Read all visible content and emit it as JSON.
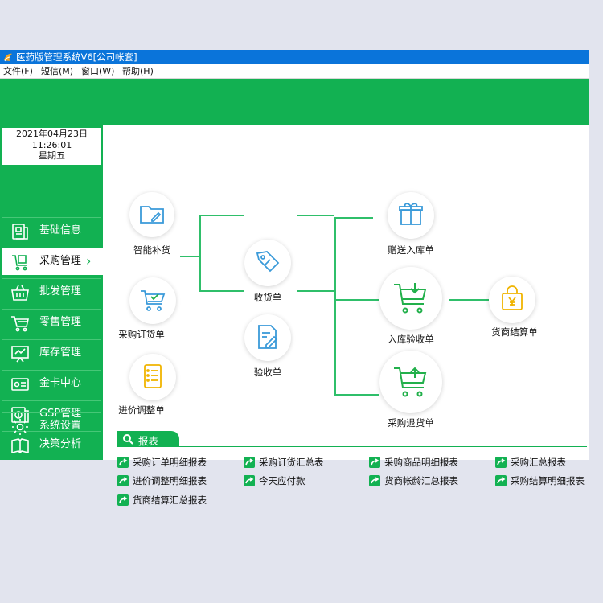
{
  "window": {
    "title": "医药版管理系统V6[公司帐套]"
  },
  "menu": [
    {
      "label": "文件(F)"
    },
    {
      "label": "短信(M)"
    },
    {
      "label": "窗口(W)"
    },
    {
      "label": "帮助(H)"
    }
  ],
  "clock": {
    "date": "2021年04月23日",
    "time": "11:26:01",
    "weekday": "星期五"
  },
  "sidebar": {
    "items": [
      {
        "label": "基础信息",
        "icon": "info-doc-icon"
      },
      {
        "label": "采购管理",
        "icon": "purchase-icon",
        "active": true
      },
      {
        "label": "批发管理",
        "icon": "basket-icon"
      },
      {
        "label": "零售管理",
        "icon": "cart-icon"
      },
      {
        "label": "库存管理",
        "icon": "board-icon"
      },
      {
        "label": "金卡中心",
        "icon": "card-icon"
      },
      {
        "label": "GSP管理",
        "icon": "coins-icon"
      },
      {
        "label": "决策分析",
        "icon": "book-icon"
      },
      {
        "label": "系统设置",
        "icon": "gear-icon"
      }
    ]
  },
  "flow": {
    "smart_replenish": "智能补货",
    "purchase_order": "采购订货单",
    "price_adjust": "进价调整单",
    "receive": "收货单",
    "inspect": "验收单",
    "gift_in": "赠送入库单",
    "in_inspect": "入库验收单",
    "return": "采购退货单",
    "settle": "货商结算单"
  },
  "reports": {
    "header": "报表",
    "items": [
      "采购订单明细报表",
      "采购订货汇总表",
      "采购商品明细报表",
      "采购汇总报表",
      "进价调整明细报表",
      "今天应付款",
      "货商帐龄汇总报表",
      "采购结算明细报表",
      "货商结算汇总报表"
    ]
  },
  "colors": {
    "brand_green": "#12b152",
    "title_blue": "#0a74da",
    "icon_blue": "#3a9ad9",
    "icon_green": "#22b04b",
    "icon_yellow": "#f0b400"
  }
}
